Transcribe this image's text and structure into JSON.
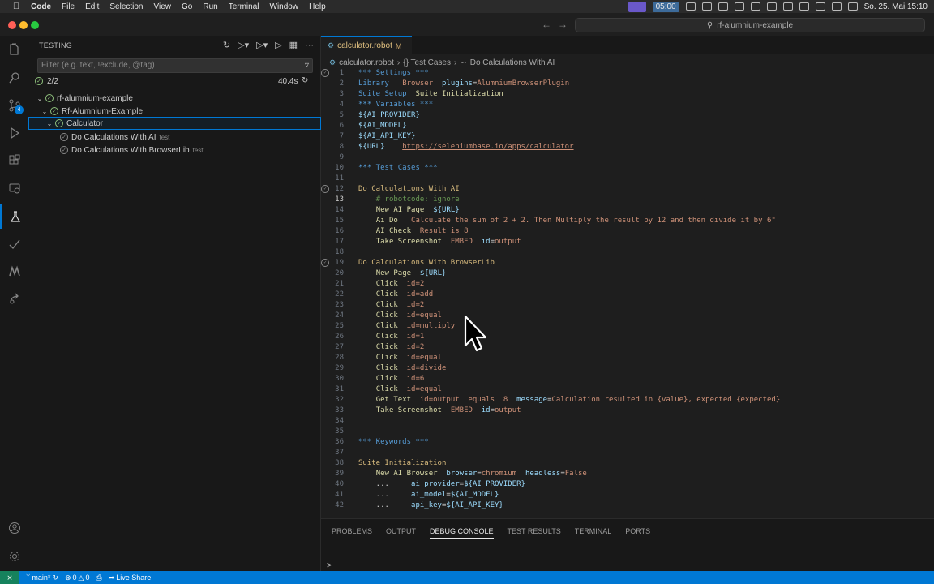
{
  "menubar": {
    "app_name": "Code",
    "items": [
      "File",
      "Edit",
      "Selection",
      "View",
      "Go",
      "Run",
      "Terminal",
      "Window",
      "Help"
    ],
    "timer": "05:00",
    "datetime": "So. 25. Mai  15:10"
  },
  "titlebar": {
    "search_text": "rf-alumnium-example"
  },
  "activity": {
    "scm_badge": "4"
  },
  "sidebar": {
    "title": "TESTING",
    "filter_placeholder": "Filter (e.g. text, !exclude, @tag)",
    "summary_count": "2/2",
    "summary_time": "40.4s",
    "tree": [
      {
        "label": "rf-alumnium-example",
        "desc": ""
      },
      {
        "label": "Rf-Alumnium-Example",
        "desc": ""
      },
      {
        "label": "Calculator",
        "desc": ""
      },
      {
        "label": "Do Calculations With AI",
        "desc": "test"
      },
      {
        "label": "Do Calculations With BrowserLib",
        "desc": "test"
      }
    ]
  },
  "editor": {
    "tab_label": "calculator.robot",
    "tab_modified": "M",
    "breadcrumb": [
      "calculator.robot",
      "{} Test Cases",
      "Do Calculations With AI"
    ],
    "lines": [
      {
        "n": "1",
        "parts": [
          [
            "h",
            "*** Settings ***"
          ]
        ]
      },
      {
        "n": "2",
        "parts": [
          [
            "h",
            "Library"
          ],
          [
            "plain",
            "   "
          ],
          [
            "arg",
            "Browser"
          ],
          [
            "plain",
            "  "
          ],
          [
            "var",
            "plugins"
          ],
          [
            "plain",
            "="
          ],
          [
            "arg",
            "AlumniumBrowserPlugin"
          ]
        ]
      },
      {
        "n": "3",
        "parts": [
          [
            "h",
            "Suite Setup"
          ],
          [
            "plain",
            "  "
          ],
          [
            "kw",
            "Suite Initialization"
          ]
        ]
      },
      {
        "n": "4",
        "parts": [
          [
            "h",
            "*** Variables ***"
          ]
        ]
      },
      {
        "n": "5",
        "parts": [
          [
            "var",
            "${AI_PROVIDER}"
          ]
        ]
      },
      {
        "n": "6",
        "parts": [
          [
            "var",
            "${AI_MODEL}"
          ]
        ]
      },
      {
        "n": "7",
        "parts": [
          [
            "var",
            "${AI_API_KEY}"
          ]
        ]
      },
      {
        "n": "8",
        "parts": [
          [
            "var",
            "${URL}"
          ],
          [
            "plain",
            "    "
          ],
          [
            "url",
            "https://seleniumbase.io/apps/calculator"
          ]
        ]
      },
      {
        "n": "9",
        "parts": []
      },
      {
        "n": "10",
        "parts": [
          [
            "h",
            "*** Test Cases ***"
          ]
        ]
      },
      {
        "n": "11",
        "parts": []
      },
      {
        "n": "12",
        "parts": [
          [
            "tc",
            "Do Calculations With AI"
          ]
        ]
      },
      {
        "n": "13",
        "parts": [
          [
            "plain",
            "    "
          ],
          [
            "cm",
            "# robotcode: ignore"
          ]
        ]
      },
      {
        "n": "14",
        "parts": [
          [
            "plain",
            "    "
          ],
          [
            "kw",
            "New AI Page"
          ],
          [
            "plain",
            "  "
          ],
          [
            "var",
            "${URL}"
          ]
        ]
      },
      {
        "n": "15",
        "parts": [
          [
            "plain",
            "    "
          ],
          [
            "kw",
            "Ai Do"
          ],
          [
            "plain",
            "   "
          ],
          [
            "arg",
            "Calculate the sum of 2 + 2. Then Multiply the result by 12 and then divide it by 6\""
          ]
        ]
      },
      {
        "n": "16",
        "parts": [
          [
            "plain",
            "    "
          ],
          [
            "kw",
            "AI Check"
          ],
          [
            "plain",
            "  "
          ],
          [
            "arg",
            "Result is 8"
          ]
        ]
      },
      {
        "n": "17",
        "parts": [
          [
            "plain",
            "    "
          ],
          [
            "kw",
            "Take Screenshot"
          ],
          [
            "plain",
            "  "
          ],
          [
            "arg",
            "EMBED"
          ],
          [
            "plain",
            "  "
          ],
          [
            "var",
            "id"
          ],
          [
            "plain",
            "="
          ],
          [
            "arg",
            "output"
          ]
        ]
      },
      {
        "n": "18",
        "parts": []
      },
      {
        "n": "19",
        "parts": [
          [
            "tc",
            "Do Calculations With BrowserLib"
          ]
        ]
      },
      {
        "n": "20",
        "parts": [
          [
            "plain",
            "    "
          ],
          [
            "kw",
            "New Page"
          ],
          [
            "plain",
            "  "
          ],
          [
            "var",
            "${URL}"
          ]
        ]
      },
      {
        "n": "21",
        "parts": [
          [
            "plain",
            "    "
          ],
          [
            "kw",
            "Click"
          ],
          [
            "plain",
            "  "
          ],
          [
            "arg",
            "id=2"
          ]
        ]
      },
      {
        "n": "22",
        "parts": [
          [
            "plain",
            "    "
          ],
          [
            "kw",
            "Click"
          ],
          [
            "plain",
            "  "
          ],
          [
            "arg",
            "id=add"
          ]
        ]
      },
      {
        "n": "23",
        "parts": [
          [
            "plain",
            "    "
          ],
          [
            "kw",
            "Click"
          ],
          [
            "plain",
            "  "
          ],
          [
            "arg",
            "id=2"
          ]
        ]
      },
      {
        "n": "24",
        "parts": [
          [
            "plain",
            "    "
          ],
          [
            "kw",
            "Click"
          ],
          [
            "plain",
            "  "
          ],
          [
            "arg",
            "id=equal"
          ]
        ]
      },
      {
        "n": "25",
        "parts": [
          [
            "plain",
            "    "
          ],
          [
            "kw",
            "Click"
          ],
          [
            "plain",
            "  "
          ],
          [
            "arg",
            "id=multiply"
          ]
        ]
      },
      {
        "n": "26",
        "parts": [
          [
            "plain",
            "    "
          ],
          [
            "kw",
            "Click"
          ],
          [
            "plain",
            "  "
          ],
          [
            "arg",
            "id=1"
          ]
        ]
      },
      {
        "n": "27",
        "parts": [
          [
            "plain",
            "    "
          ],
          [
            "kw",
            "Click"
          ],
          [
            "plain",
            "  "
          ],
          [
            "arg",
            "id=2"
          ]
        ]
      },
      {
        "n": "28",
        "parts": [
          [
            "plain",
            "    "
          ],
          [
            "kw",
            "Click"
          ],
          [
            "plain",
            "  "
          ],
          [
            "arg",
            "id=equal"
          ]
        ]
      },
      {
        "n": "29",
        "parts": [
          [
            "plain",
            "    "
          ],
          [
            "kw",
            "Click"
          ],
          [
            "plain",
            "  "
          ],
          [
            "arg",
            "id=divide"
          ]
        ]
      },
      {
        "n": "30",
        "parts": [
          [
            "plain",
            "    "
          ],
          [
            "kw",
            "Click"
          ],
          [
            "plain",
            "  "
          ],
          [
            "arg",
            "id=6"
          ]
        ]
      },
      {
        "n": "31",
        "parts": [
          [
            "plain",
            "    "
          ],
          [
            "kw",
            "Click"
          ],
          [
            "plain",
            "  "
          ],
          [
            "arg",
            "id=equal"
          ]
        ]
      },
      {
        "n": "32",
        "parts": [
          [
            "plain",
            "    "
          ],
          [
            "kw",
            "Get Text"
          ],
          [
            "plain",
            "  "
          ],
          [
            "arg",
            "id=output"
          ],
          [
            "plain",
            "  "
          ],
          [
            "arg",
            "equals"
          ],
          [
            "plain",
            "  "
          ],
          [
            "arg",
            "8"
          ],
          [
            "plain",
            "  "
          ],
          [
            "var",
            "message"
          ],
          [
            "plain",
            "="
          ],
          [
            "arg",
            "Calculation resulted in {value}, expected {expected}"
          ]
        ]
      },
      {
        "n": "33",
        "parts": [
          [
            "plain",
            "    "
          ],
          [
            "kw",
            "Take Screenshot"
          ],
          [
            "plain",
            "  "
          ],
          [
            "arg",
            "EMBED"
          ],
          [
            "plain",
            "  "
          ],
          [
            "var",
            "id"
          ],
          [
            "plain",
            "="
          ],
          [
            "arg",
            "output"
          ]
        ]
      },
      {
        "n": "34",
        "parts": []
      },
      {
        "n": "35",
        "parts": []
      },
      {
        "n": "36",
        "parts": [
          [
            "h",
            "*** Keywords ***"
          ]
        ]
      },
      {
        "n": "37",
        "parts": []
      },
      {
        "n": "38",
        "parts": [
          [
            "tc",
            "Suite Initialization"
          ]
        ]
      },
      {
        "n": "39",
        "parts": [
          [
            "plain",
            "    "
          ],
          [
            "kw",
            "New AI Browser"
          ],
          [
            "plain",
            "  "
          ],
          [
            "var",
            "browser"
          ],
          [
            "plain",
            "="
          ],
          [
            "arg",
            "chromium"
          ],
          [
            "plain",
            "  "
          ],
          [
            "var",
            "headless"
          ],
          [
            "plain",
            "="
          ],
          [
            "arg",
            "False"
          ]
        ]
      },
      {
        "n": "40",
        "parts": [
          [
            "plain",
            "    ...     "
          ],
          [
            "var",
            "ai_provider"
          ],
          [
            "plain",
            "="
          ],
          [
            "var",
            "${AI_PROVIDER}"
          ]
        ]
      },
      {
        "n": "41",
        "parts": [
          [
            "plain",
            "    ...     "
          ],
          [
            "var",
            "ai_model"
          ],
          [
            "plain",
            "="
          ],
          [
            "var",
            "${AI_MODEL}"
          ]
        ]
      },
      {
        "n": "42",
        "parts": [
          [
            "plain",
            "    ...     "
          ],
          [
            "var",
            "api_key"
          ],
          [
            "plain",
            "="
          ],
          [
            "var",
            "${AI_API_KEY}"
          ]
        ]
      }
    ]
  },
  "panel": {
    "tabs": [
      "PROBLEMS",
      "OUTPUT",
      "DEBUG CONSOLE",
      "TEST RESULTS",
      "TERMINAL",
      "PORTS"
    ],
    "active_tab": "DEBUG CONSOLE",
    "prompt": ">"
  },
  "statusbar": {
    "branch": "main*",
    "errors": "0",
    "warnings": "0",
    "live_share": "Live Share"
  },
  "colors": {
    "accent": "#0078d4",
    "pass": "#8ec07c",
    "remote": "#16825d"
  }
}
